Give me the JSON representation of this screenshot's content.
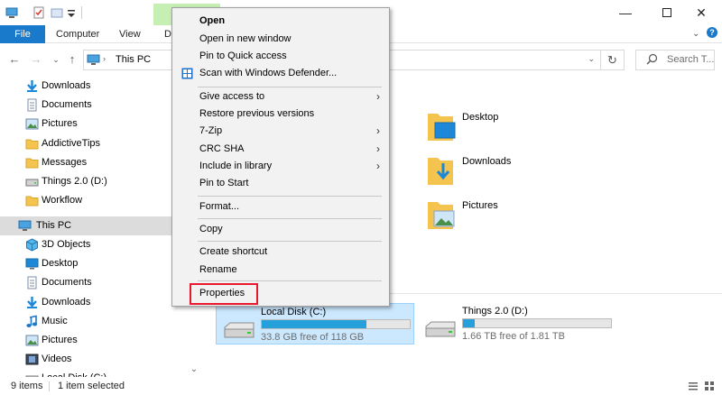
{
  "ribbon": {
    "tabs": [
      "File",
      "Computer",
      "View",
      "D"
    ]
  },
  "address": {
    "path": "This PC",
    "search_placeholder": "Search T..."
  },
  "nav": {
    "quick": [
      {
        "label": "Downloads",
        "icon": "download-arrow-icon"
      },
      {
        "label": "Documents",
        "icon": "document-icon"
      },
      {
        "label": "Pictures",
        "icon": "pictures-icon"
      },
      {
        "label": "AddictiveTips",
        "icon": "folder-icon"
      },
      {
        "label": "Messages",
        "icon": "folder-icon"
      },
      {
        "label": "Things 2.0 (D:)",
        "icon": "drive-icon"
      },
      {
        "label": "Workflow",
        "icon": "folder-icon"
      }
    ],
    "this_pc": "This PC",
    "pc_items": [
      {
        "label": "3D Objects",
        "icon": "cube-icon"
      },
      {
        "label": "Desktop",
        "icon": "desktop-icon"
      },
      {
        "label": "Documents",
        "icon": "document-icon"
      },
      {
        "label": "Downloads",
        "icon": "download-arrow-icon"
      },
      {
        "label": "Music",
        "icon": "music-note-icon"
      },
      {
        "label": "Pictures",
        "icon": "pictures-icon"
      },
      {
        "label": "Videos",
        "icon": "video-icon"
      },
      {
        "label": "Local Disk (C:)",
        "icon": "drive-icon"
      }
    ]
  },
  "folders": [
    {
      "label": "Desktop"
    },
    {
      "label": "Downloads"
    },
    {
      "label": "Pictures"
    }
  ],
  "drives": [
    {
      "name": "Local Disk (C:)",
      "free": "33.8 GB free of 118 GB",
      "used_fraction": 0.71
    },
    {
      "name": "Things 2.0 (D:)",
      "free": "1.66 TB free of 1.81 TB",
      "used_fraction": 0.08
    }
  ],
  "status": {
    "items": "9 items",
    "selected": "1 item selected"
  },
  "context_menu": {
    "open": "Open",
    "open_new_window": "Open in new window",
    "pin_quick_access": "Pin to Quick access",
    "scan_defender": "Scan with Windows Defender...",
    "give_access": "Give access to",
    "restore_versions": "Restore previous versions",
    "seven_zip": "7-Zip",
    "crc_sha": "CRC SHA",
    "include_library": "Include in library",
    "pin_start": "Pin to Start",
    "format": "Format...",
    "copy": "Copy",
    "create_shortcut": "Create shortcut",
    "rename": "Rename",
    "properties": "Properties"
  },
  "colors": {
    "accent": "#1979ca",
    "selection": "#cce8ff",
    "drive_bar": "#26a0da",
    "highlight_box": "#e8192c",
    "folder": "#f4c44e"
  }
}
